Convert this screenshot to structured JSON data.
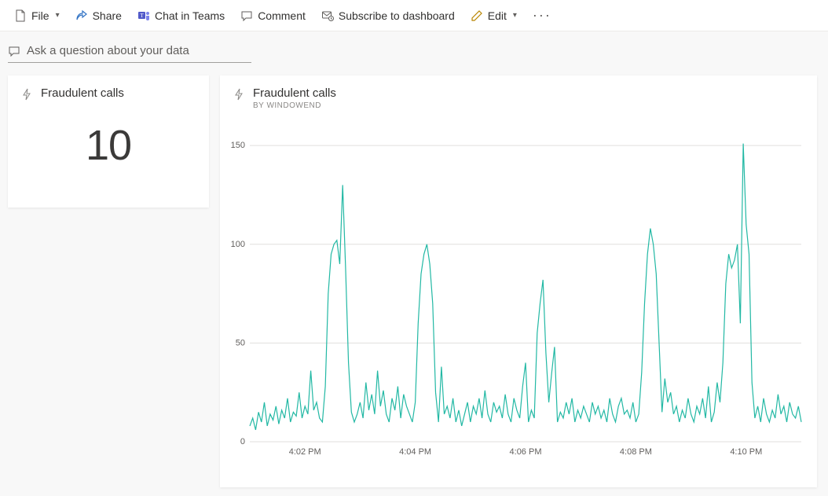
{
  "toolbar": {
    "file": "File",
    "share": "Share",
    "chat": "Chat in Teams",
    "comment": "Comment",
    "subscribe": "Subscribe to dashboard",
    "edit": "Edit"
  },
  "ask": {
    "placeholder": "Ask a question about your data"
  },
  "kpi": {
    "title": "Fraudulent calls",
    "value": "10"
  },
  "chart": {
    "title": "Fraudulent calls",
    "subtitle": "By WindowEnd"
  },
  "chart_data": {
    "type": "line",
    "title": "Fraudulent calls by WindowEnd",
    "xlabel": "",
    "ylabel": "",
    "ylim": [
      0,
      160
    ],
    "y_ticks": [
      0,
      50,
      100,
      150
    ],
    "x_ticks": [
      "4:02 PM",
      "4:04 PM",
      "4:06 PM",
      "4:08 PM",
      "4:10 PM"
    ],
    "x_tick_positions": [
      0.1,
      0.3,
      0.5,
      0.7,
      0.9
    ],
    "series": [
      {
        "name": "Fraudulent calls",
        "color": "#22b8a4",
        "values": [
          8,
          12,
          6,
          15,
          10,
          20,
          8,
          14,
          11,
          18,
          9,
          16,
          12,
          22,
          10,
          15,
          13,
          25,
          12,
          18,
          14,
          36,
          16,
          20,
          12,
          10,
          28,
          75,
          95,
          100,
          102,
          90,
          130,
          88,
          40,
          15,
          10,
          14,
          20,
          12,
          30,
          16,
          24,
          14,
          36,
          18,
          26,
          14,
          10,
          22,
          16,
          28,
          12,
          24,
          18,
          14,
          10,
          20,
          60,
          85,
          95,
          100,
          90,
          70,
          25,
          10,
          38,
          14,
          18,
          12,
          22,
          10,
          16,
          8,
          14,
          20,
          10,
          18,
          14,
          22,
          12,
          26,
          14,
          10,
          20,
          15,
          18,
          12,
          24,
          14,
          10,
          22,
          16,
          12,
          28,
          40,
          10,
          16,
          12,
          55,
          70,
          82,
          45,
          20,
          35,
          48,
          10,
          15,
          12,
          20,
          14,
          22,
          10,
          16,
          12,
          18,
          14,
          10,
          20,
          14,
          18,
          12,
          16,
          10,
          22,
          14,
          10,
          18,
          22,
          14,
          16,
          12,
          20,
          10,
          14,
          35,
          70,
          95,
          108,
          100,
          85,
          50,
          15,
          32,
          20,
          25,
          14,
          18,
          10,
          16,
          12,
          22,
          14,
          10,
          18,
          14,
          22,
          12,
          28,
          10,
          15,
          30,
          20,
          40,
          80,
          95,
          88,
          92,
          100,
          60,
          151,
          110,
          95,
          30,
          12,
          18,
          10,
          22,
          14,
          10,
          16,
          12,
          24,
          14,
          18,
          10,
          20,
          14,
          12,
          18,
          10
        ]
      }
    ]
  }
}
